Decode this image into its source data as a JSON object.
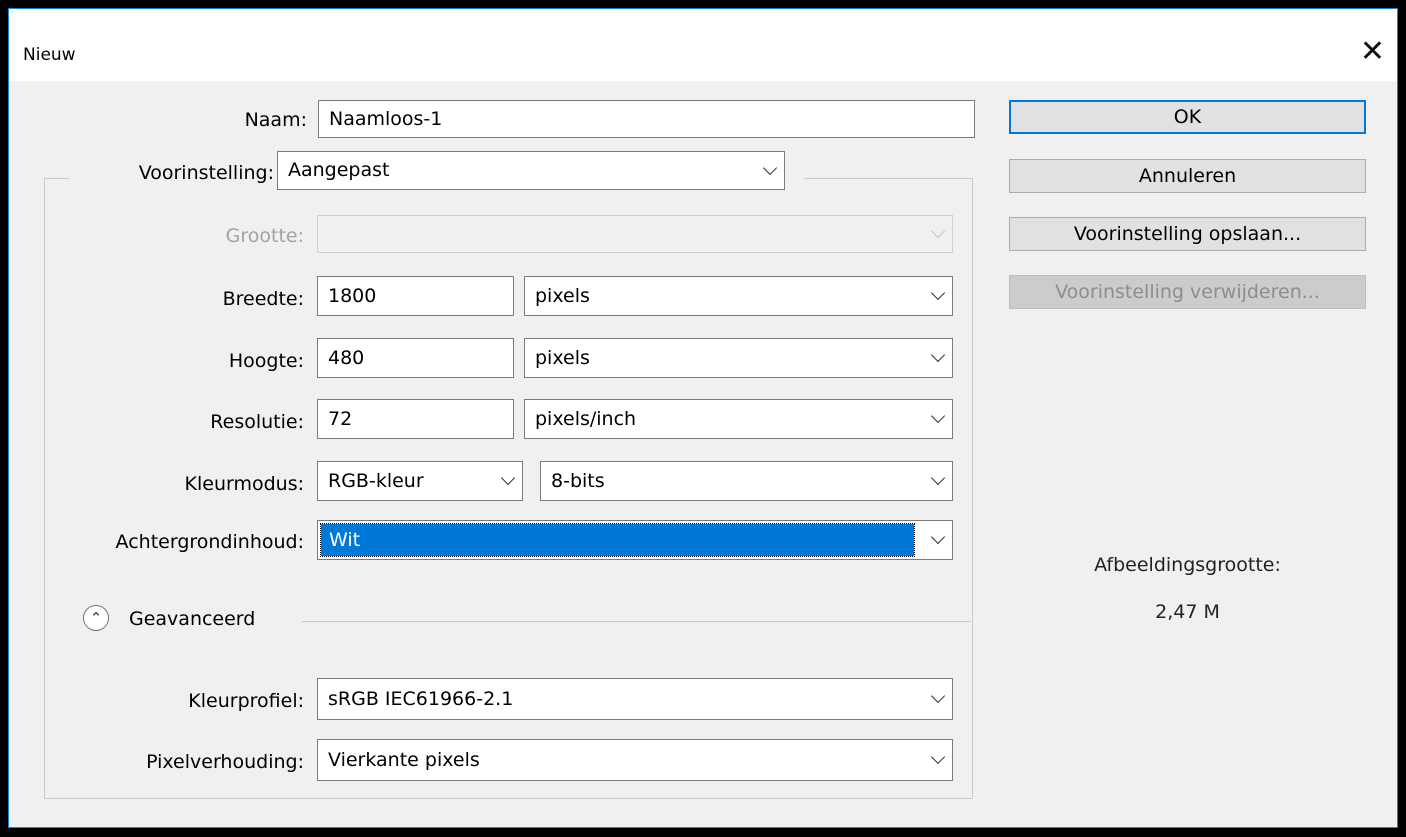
{
  "title": "Nieuw",
  "close_glyph": "✕",
  "fields": {
    "naam": {
      "label": "Naam:",
      "value": "Naamloos-1"
    },
    "voorinstelling": {
      "label": "Voorinstelling:",
      "value": "Aangepast"
    },
    "grootte": {
      "label": "Grootte:",
      "value": ""
    },
    "breedte": {
      "label": "Breedte:",
      "value": "1800",
      "unit": "pixels"
    },
    "hoogte": {
      "label": "Hoogte:",
      "value": "480",
      "unit": "pixels"
    },
    "resolutie": {
      "label": "Resolutie:",
      "value": "72",
      "unit": "pixels/inch"
    },
    "kleurmodus": {
      "label": "Kleurmodus:",
      "value": "RGB-kleur",
      "bits": "8-bits"
    },
    "achtergrond": {
      "label": "Achtergrondinhoud:",
      "value": "Wit"
    },
    "kleurprofiel": {
      "label": "Kleurprofiel:",
      "value": "sRGB IEC61966-2.1"
    },
    "pixelverhouding": {
      "label": "Pixelverhouding:",
      "value": "Vierkante pixels"
    }
  },
  "advanced": {
    "label": "Geavanceerd",
    "icon": "collapse-up-icon"
  },
  "buttons": {
    "ok": "OK",
    "cancel": "Annuleren",
    "save_preset": "Voorinstelling opslaan...",
    "delete_preset": "Voorinstelling verwijderen..."
  },
  "info": {
    "label": "Afbeeldingsgrootte:",
    "value": "2,47 M"
  },
  "colors": {
    "accent": "#0078d7",
    "dialog_bg": "#f0f0f0"
  }
}
